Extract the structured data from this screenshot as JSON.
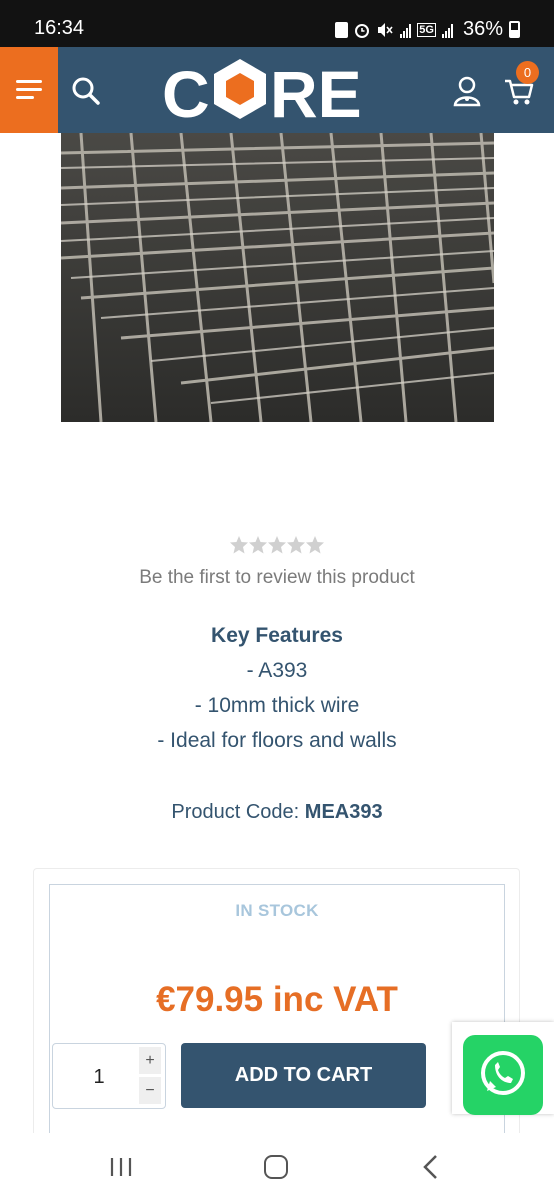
{
  "status_bar": {
    "time": "16:34",
    "battery": "36%",
    "network": "5G",
    "icons": [
      "battery-saver-icon",
      "alarm-icon",
      "mute-icon",
      "signal-icon",
      "signal-5g-icon",
      "battery-icon"
    ]
  },
  "header": {
    "menu_icon": "hamburger-icon",
    "search_icon": "search-icon",
    "logo_text": "CORE",
    "account_icon": "account-icon",
    "cart_icon": "cart-icon",
    "cart_count": "0",
    "colors": {
      "bar": "#34546f",
      "accent": "#ec6e1f"
    }
  },
  "product": {
    "image_icon": "wire-mesh-photo",
    "rating": {
      "stars_filled": 0,
      "stars_total": 5
    },
    "review_prompt": "Be the first to review this product",
    "features_title": "Key Features",
    "features": [
      "- A393",
      "- 10mm thick wire",
      "- Ideal for floors and walls"
    ],
    "code_label": "Product Code:",
    "code_value": "MEA393"
  },
  "buy_box": {
    "stock_status": "IN STOCK",
    "price": "€79.95 inc VAT",
    "quantity": "1",
    "plus_label": "+",
    "minus_label": "−",
    "add_to_cart_label": "ADD TO CART",
    "colors": {
      "price": "#e66e25",
      "stock": "#a8c6dc",
      "button": "#34546f"
    }
  },
  "whatsapp": {
    "icon": "whatsapp-icon",
    "color": "#25d366"
  },
  "nav_bar": {
    "recents_icon": "recents-icon",
    "home_icon": "home-icon",
    "back_icon": "back-icon"
  }
}
